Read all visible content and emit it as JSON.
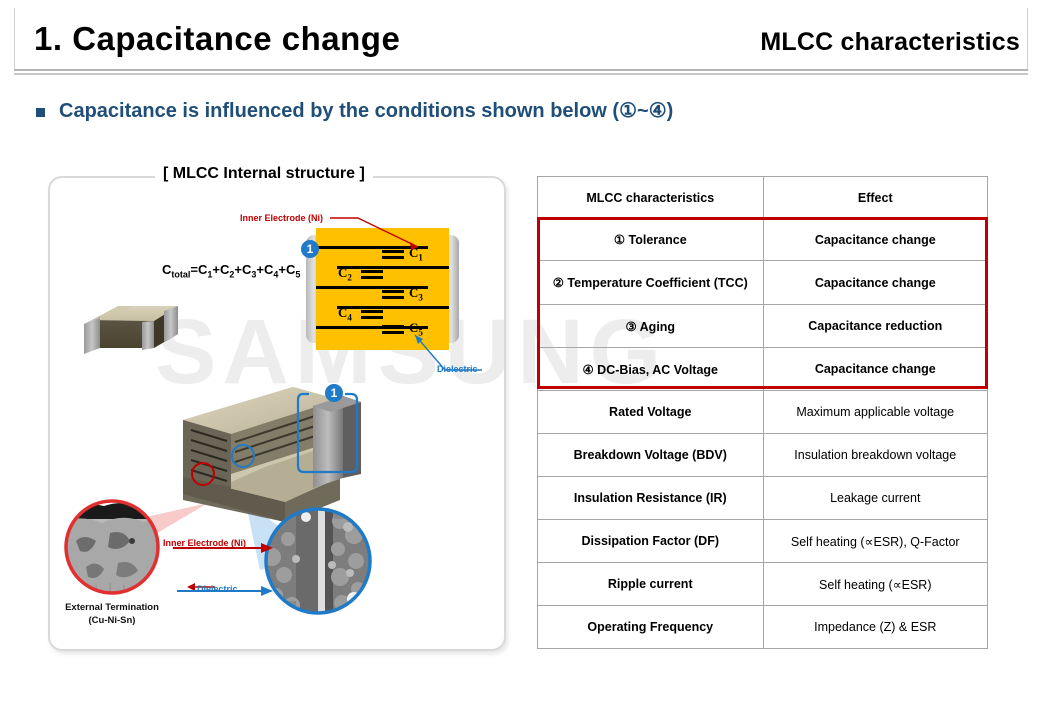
{
  "header": {
    "title": "1. Capacitance change",
    "subtitle": "MLCC characteristics"
  },
  "bullet": {
    "text": "Capacitance is influenced by the conditions shown below (①~④)"
  },
  "left_panel": {
    "title": "[ MLCC Internal structure ]",
    "formula": "Ctotal=C1+C2+C3+C4+C5",
    "formula_parts": {
      "base": "C",
      "sub_total": "total",
      "rest": "=C1+C2+C3+C4+C5"
    },
    "marker_badge": "1",
    "capacitor_labels": [
      "C1",
      "C2",
      "C3",
      "C4",
      "C5"
    ],
    "callouts": {
      "inner_electrode_top": "Inner Electrode (Ni)",
      "dielectric_top": "Dielectric",
      "inner_electrode_bottom": "Inner Electrode (Ni)",
      "dielectric_bottom": "Dielectric",
      "external_termination_line1": "External Termination",
      "external_termination_line2": "(Cu-Ni-Sn)"
    }
  },
  "watermark": {
    "text": "SAMSUNG"
  },
  "table": {
    "headers": [
      "MLCC characteristics",
      "Effect"
    ],
    "rows": [
      {
        "characteristic": "① Tolerance",
        "effect": "Capacitance change",
        "highlighted": true
      },
      {
        "characteristic": "② Temperature Coefficient (TCC)",
        "effect": "Capacitance change",
        "highlighted": true
      },
      {
        "characteristic": "③ Aging",
        "effect": "Capacitance reduction",
        "highlighted": true
      },
      {
        "characteristic": "④ DC-Bias, AC Voltage",
        "effect": "Capacitance change",
        "highlighted": true
      },
      {
        "characteristic": "Rated Voltage",
        "effect": "Maximum  applicable voltage",
        "highlighted": false
      },
      {
        "characteristic": "Breakdown Voltage (BDV)",
        "effect": "Insulation breakdown voltage",
        "highlighted": false
      },
      {
        "characteristic": "Insulation Resistance (IR)",
        "effect": "Leakage current",
        "highlighted": false
      },
      {
        "characteristic": "Dissipation Factor (DF)",
        "effect": "Self heating (∝ESR), Q-Factor",
        "highlighted": false
      },
      {
        "characteristic": "Ripple current",
        "effect": "Self heating (∝ESR)",
        "highlighted": false
      },
      {
        "characteristic": "Operating Frequency",
        "effect": "Impedance (Z) & ESR",
        "highlighted": false
      }
    ]
  },
  "colors": {
    "bullet_blue": "#1f4e79",
    "highlight_red": "#c00000",
    "marker_blue": "#1f7ac7",
    "dielectric_yellow": "#ffc000",
    "table_border": "#a6a6a6",
    "watermark_gray": "#ededed"
  }
}
